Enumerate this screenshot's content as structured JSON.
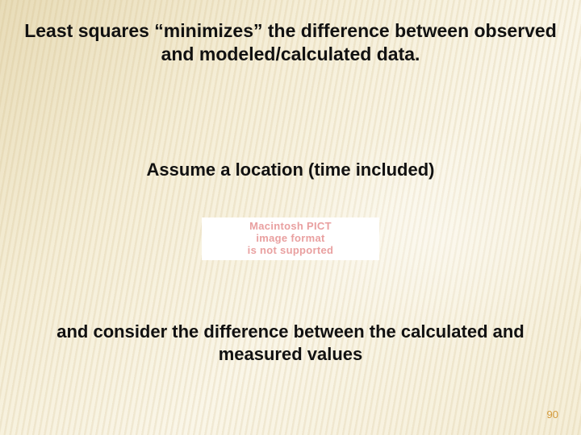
{
  "slide": {
    "heading": "Least squares “minimizes” the difference between observed and modeled/calculated data.",
    "mid": "Assume a location (time included)",
    "placeholder": {
      "line1": "Macintosh PICT",
      "line2": "image format",
      "line3": "is not supported"
    },
    "bottom": "and consider the difference between the calculated and measured values",
    "page_number": "90"
  }
}
